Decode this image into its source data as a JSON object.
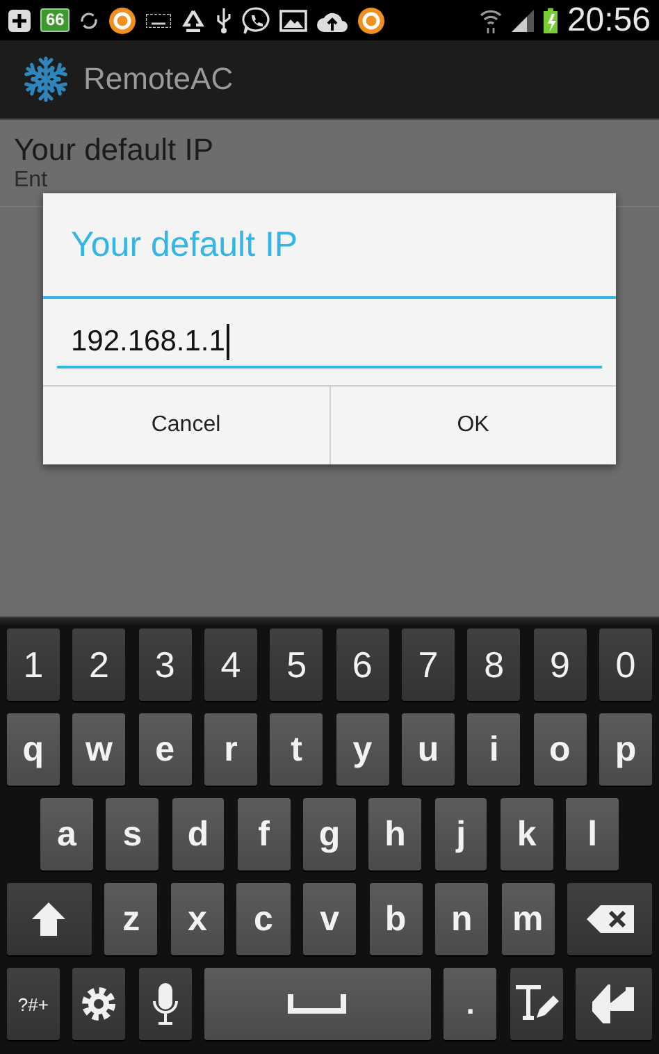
{
  "status_bar": {
    "battery_badge": "66",
    "time": "20:56"
  },
  "app_bar": {
    "title": "RemoteAC"
  },
  "preference": {
    "title": "Your default IP",
    "summary": "Ent"
  },
  "dialog": {
    "title": "Your default IP",
    "input": {
      "value": "192.168.1.1",
      "focused": true
    },
    "buttons": [
      "Cancel",
      "OK"
    ]
  },
  "keyboard": {
    "rows": [
      [
        {
          "kind": "digit",
          "label": "1"
        },
        {
          "kind": "digit",
          "label": "2"
        },
        {
          "kind": "digit",
          "label": "3"
        },
        {
          "kind": "digit",
          "label": "4"
        },
        {
          "kind": "digit",
          "label": "5"
        },
        {
          "kind": "digit",
          "label": "6"
        },
        {
          "kind": "digit",
          "label": "7"
        },
        {
          "kind": "digit",
          "label": "8"
        },
        {
          "kind": "digit",
          "label": "9"
        },
        {
          "kind": "digit",
          "label": "0"
        }
      ],
      [
        {
          "kind": "letter",
          "label": "q"
        },
        {
          "kind": "letter",
          "label": "w"
        },
        {
          "kind": "letter",
          "label": "e"
        },
        {
          "kind": "letter",
          "label": "r"
        },
        {
          "kind": "letter",
          "label": "t"
        },
        {
          "kind": "letter",
          "label": "y"
        },
        {
          "kind": "letter",
          "label": "u"
        },
        {
          "kind": "letter",
          "label": "i"
        },
        {
          "kind": "letter",
          "label": "o"
        },
        {
          "kind": "letter",
          "label": "p"
        }
      ],
      [
        {
          "kind": "letter",
          "label": "a"
        },
        {
          "kind": "letter",
          "label": "s"
        },
        {
          "kind": "letter",
          "label": "d"
        },
        {
          "kind": "letter",
          "label": "f"
        },
        {
          "kind": "letter",
          "label": "g"
        },
        {
          "kind": "letter",
          "label": "h"
        },
        {
          "kind": "letter",
          "label": "j"
        },
        {
          "kind": "letter",
          "label": "k"
        },
        {
          "kind": "letter",
          "label": "l"
        }
      ],
      [
        {
          "kind": "shift"
        },
        {
          "kind": "letter",
          "label": "z"
        },
        {
          "kind": "letter",
          "label": "x"
        },
        {
          "kind": "letter",
          "label": "c"
        },
        {
          "kind": "letter",
          "label": "v"
        },
        {
          "kind": "letter",
          "label": "b"
        },
        {
          "kind": "letter",
          "label": "n"
        },
        {
          "kind": "letter",
          "label": "m"
        },
        {
          "kind": "backspace"
        }
      ],
      [
        {
          "kind": "symbols",
          "label": "?#+"
        },
        {
          "kind": "settings"
        },
        {
          "kind": "mic"
        },
        {
          "kind": "space"
        },
        {
          "kind": "period",
          "label": "."
        },
        {
          "kind": "handwriting"
        },
        {
          "kind": "enter"
        }
      ]
    ]
  }
}
